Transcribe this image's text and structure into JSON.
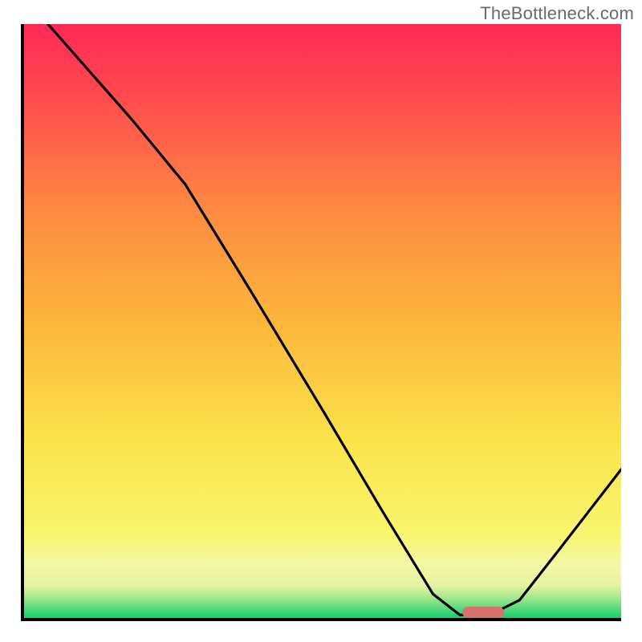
{
  "watermark": "TheBottleneck.com",
  "chart_data": {
    "type": "line",
    "title": "",
    "xlabel": "",
    "ylabel": "",
    "xlim": [
      0,
      100
    ],
    "ylim": [
      0,
      100
    ],
    "grid": false,
    "series": [
      {
        "name": "bottleneck-curve",
        "x": [
          4,
          18,
          27,
          38,
          50,
          60,
          68.5,
          73,
          78,
          83,
          90,
          100
        ],
        "y": [
          100,
          84,
          73,
          55,
          35,
          18,
          4,
          0.5,
          0.5,
          3,
          12,
          25
        ]
      }
    ],
    "marker": {
      "name": "target-marker",
      "x_start": 73,
      "x_end": 80,
      "y": 0.5,
      "color": "#d9706d"
    },
    "background_bands": [
      {
        "y_from": 0,
        "y_to": 1.2,
        "color": "#17cf6b"
      },
      {
        "y_from": 1.2,
        "y_to": 3.8,
        "color": "#a7e98e"
      },
      {
        "y_from": 3.8,
        "y_to": 9,
        "color": "#f4f7a6"
      },
      {
        "y_from": 9,
        "y_to": 55,
        "color_from": "#fbe34a",
        "color_to": "#fca93a"
      },
      {
        "y_from": 55,
        "y_to": 100,
        "color_from": "#fca93a",
        "color_to": "#ff2956"
      }
    ]
  }
}
